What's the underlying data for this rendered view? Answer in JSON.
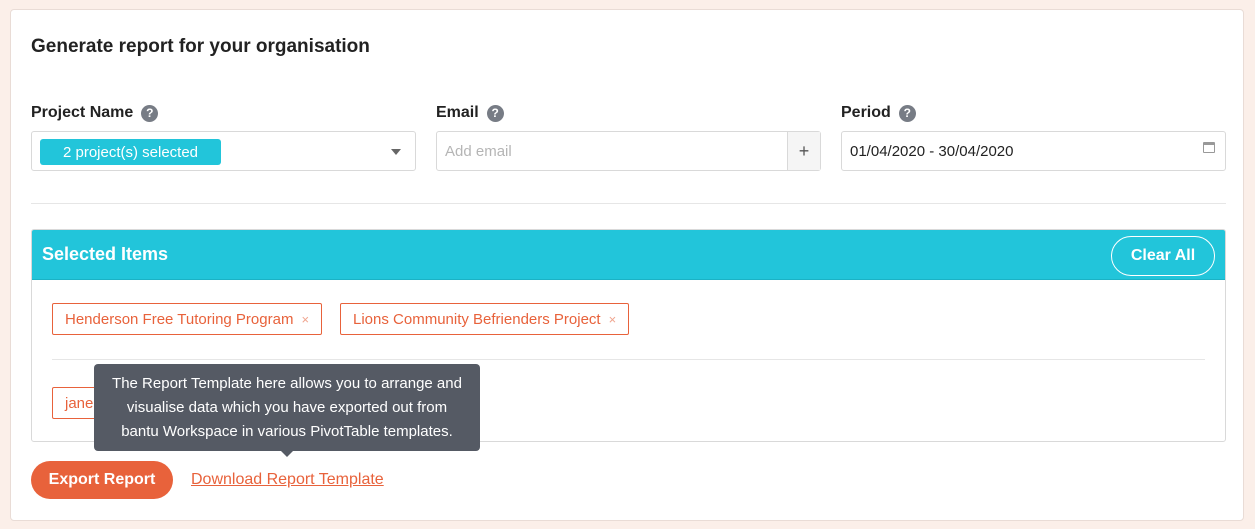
{
  "page": {
    "title": "Generate report for your organisation"
  },
  "fields": {
    "project": {
      "label": "Project Name",
      "help_icon": "?",
      "selected_chip": "2 project(s) selected"
    },
    "email": {
      "label": "Email",
      "help_icon": "?",
      "placeholder": "Add email",
      "add_label": "+"
    },
    "period": {
      "label": "Period",
      "help_icon": "?",
      "value": "01/04/2020 - 30/04/2020"
    }
  },
  "selected_items": {
    "title": "Selected Items",
    "clear_label": "Clear All",
    "projects": [
      {
        "label": "Henderson Free Tutoring Program",
        "remove": "×"
      },
      {
        "label": "Lions Community Befrienders Project",
        "remove": "×"
      }
    ],
    "emails": [
      {
        "label": "jane"
      }
    ]
  },
  "tooltip": {
    "text_line1": "The Report Template here allows you to arrange and",
    "text_line2": "visualise data which you have exported out from",
    "text_line3": "bantu Workspace in various PivotTable templates."
  },
  "actions": {
    "export_label": "Export Report",
    "download_label": "Download Report Template"
  },
  "colors": {
    "accent_cyan": "#22c5da",
    "accent_orange": "#e8623b",
    "tooltip_bg": "#555a64"
  }
}
